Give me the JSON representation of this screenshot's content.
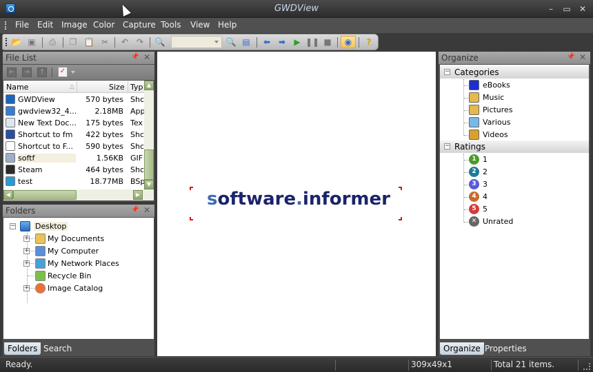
{
  "window": {
    "title": "GWDView",
    "controls": {
      "minimize": "–",
      "maximize": "▭",
      "close": "✕"
    }
  },
  "menu": [
    "File",
    "Edit",
    "Image",
    "Color",
    "Capture",
    "Tools",
    "View",
    "Help"
  ],
  "toolbar": {
    "buttons": [
      "open-folder",
      "save",
      "print",
      "copy",
      "paste",
      "cut",
      "undo",
      "redo",
      "zoom-in",
      "zoom-out",
      "fit-window",
      "previous",
      "next",
      "play-slideshow",
      "pause",
      "stop",
      "browse-folder",
      "help"
    ],
    "zoom_combo_value": ""
  },
  "file_list": {
    "title": "File List",
    "columns": {
      "name": "Name",
      "size": "Size",
      "type": "Typ"
    },
    "rows": [
      {
        "name": "GWDView",
        "size": "570 bytes",
        "type": "Shc",
        "icon": "gwdview-icon",
        "color": "#1c66c1"
      },
      {
        "name": "gwdview32_4...",
        "size": "2.18MB",
        "type": "App",
        "icon": "installer-icon",
        "color": "#3a7bd5"
      },
      {
        "name": "New Text Doc...",
        "size": "175 bytes",
        "type": "Tex",
        "icon": "text-document-icon",
        "color": "#dfe6ef"
      },
      {
        "name": "Shortcut to fm",
        "size": "422 bytes",
        "type": "Shc",
        "icon": "fm-icon",
        "color": "#2a4ea0"
      },
      {
        "name": "Shortcut to F...",
        "size": "590 bytes",
        "type": "Shc",
        "icon": "football-icon",
        "color": "#ffffff"
      },
      {
        "name": "softf",
        "size": "1.56KB",
        "type": "GIF",
        "icon": "gif-image-icon",
        "color": "#9bb0c7"
      },
      {
        "name": "Steam",
        "size": "464 bytes",
        "type": "Shc",
        "icon": "steam-icon",
        "color": "#2b2b2b"
      },
      {
        "name": "test",
        "size": "18.77MB",
        "type": "BSp",
        "icon": "bsplayer-icon",
        "color": "#2a9ad6"
      }
    ],
    "selected_index": 5
  },
  "folders": {
    "title": "Folders",
    "root": "Desktop",
    "children": [
      {
        "label": "My Documents",
        "expandable": true,
        "icon": "my-documents-icon"
      },
      {
        "label": "My Computer",
        "expandable": true,
        "icon": "my-computer-icon"
      },
      {
        "label": "My Network Places",
        "expandable": true,
        "icon": "network-places-icon"
      },
      {
        "label": "Recycle Bin",
        "expandable": false,
        "icon": "recycle-bin-icon"
      },
      {
        "label": "Image Catalog",
        "expandable": true,
        "icon": "image-catalog-icon"
      }
    ],
    "tabs": [
      "Folders",
      "Search"
    ],
    "active_tab": "Folders"
  },
  "viewer": {
    "image_text_prefix": "s",
    "image_text_mid": "oftware",
    "image_text_dot": ".",
    "image_text_suffix": "informer"
  },
  "organize": {
    "title": "Organize",
    "categories": {
      "label": "Categories",
      "items": [
        {
          "label": "eBooks",
          "icon": "ebook-icon"
        },
        {
          "label": "Music",
          "icon": "music-folder-icon"
        },
        {
          "label": "Pictures",
          "icon": "pictures-folder-icon"
        },
        {
          "label": "Various",
          "icon": "various-folder-icon"
        },
        {
          "label": "Videos",
          "icon": "videos-folder-icon"
        }
      ]
    },
    "ratings": {
      "label": "Ratings",
      "items": [
        {
          "label": "1",
          "badge": "1",
          "color": "#4c9a2a"
        },
        {
          "label": "2",
          "badge": "2",
          "color": "#1f7a99"
        },
        {
          "label": "3",
          "badge": "3",
          "color": "#5a5ad8"
        },
        {
          "label": "4",
          "badge": "4",
          "color": "#c86a2e"
        },
        {
          "label": "5",
          "badge": "5",
          "color": "#d63a3a"
        },
        {
          "label": "Unrated",
          "badge": "✕",
          "color": "#666666"
        }
      ]
    },
    "tabs": [
      "Organize",
      "Properties"
    ],
    "active_tab": "Organize"
  },
  "statusbar": {
    "status": "Ready.",
    "dimensions": "309x49x1",
    "total": "Total 21 items."
  }
}
